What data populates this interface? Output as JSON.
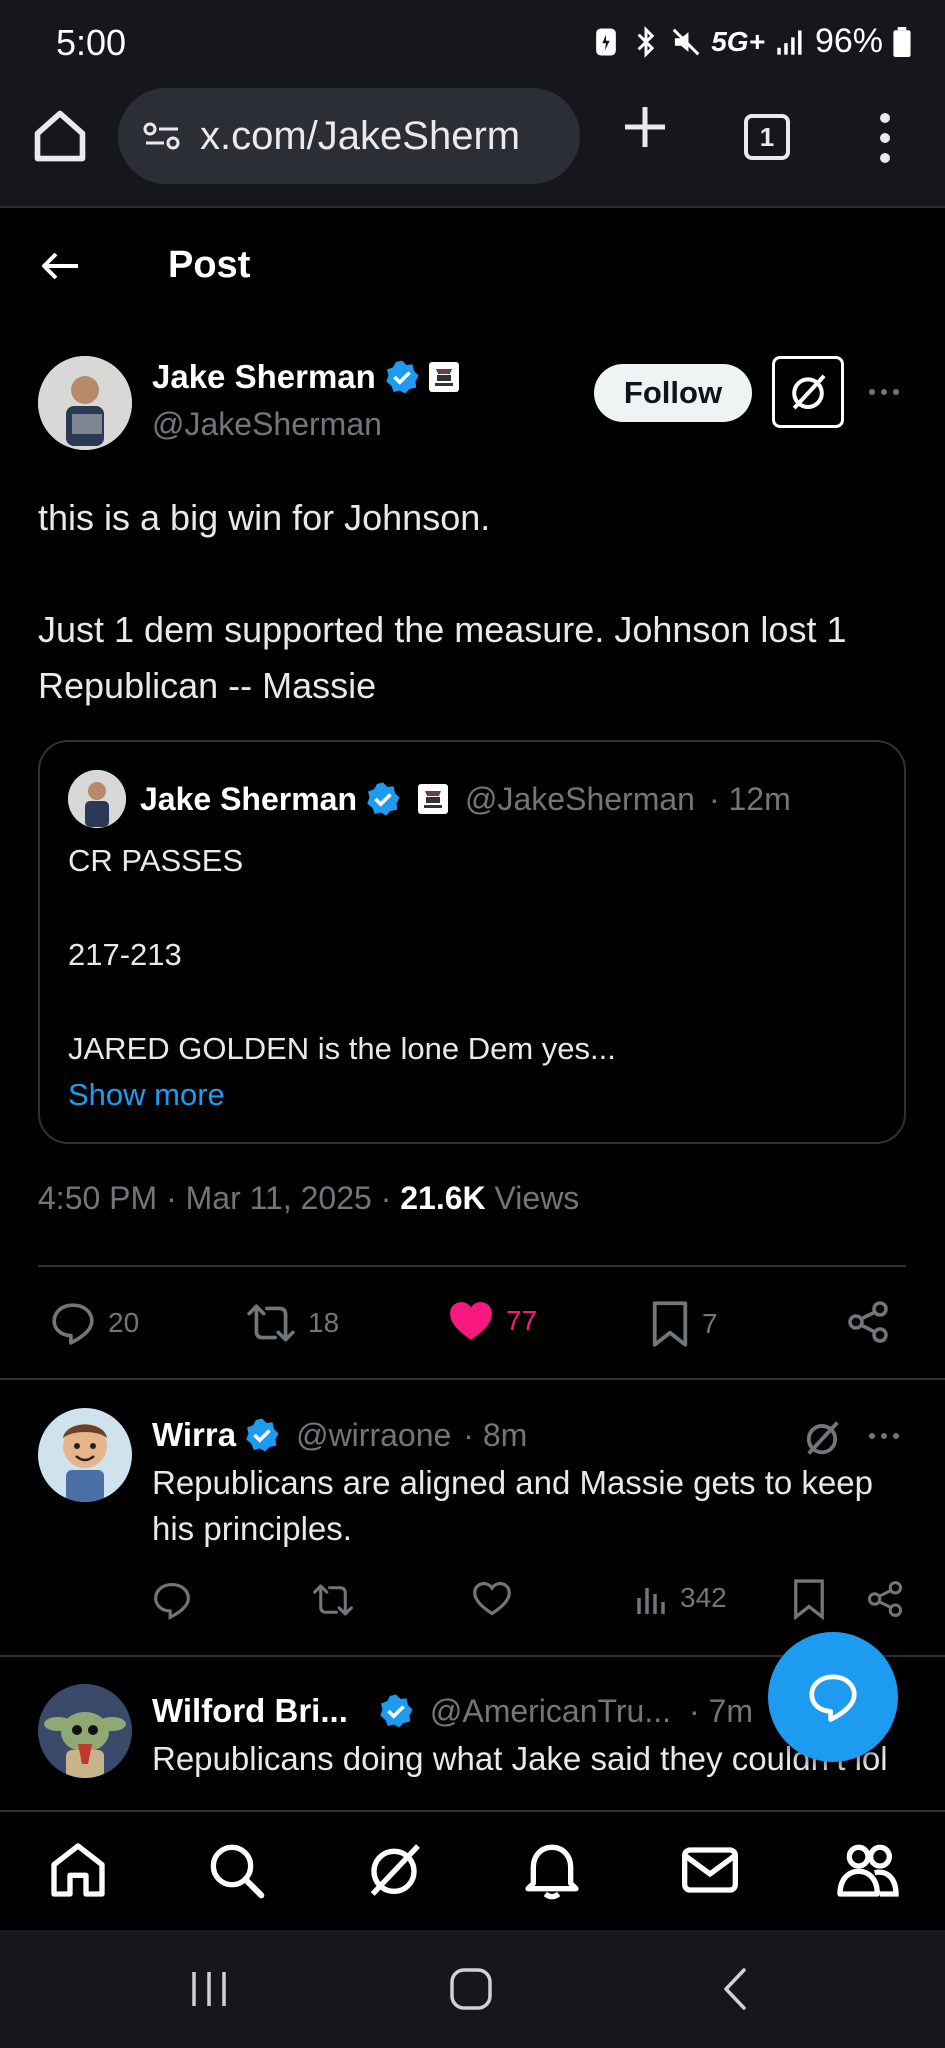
{
  "status_bar": {
    "time": "5:00",
    "network": "5G+",
    "battery": "96%"
  },
  "browser": {
    "url": "x.com/JakeSherm",
    "tab_count": "1"
  },
  "header": {
    "title": "Post"
  },
  "post": {
    "author_name": "Jake Sherman",
    "author_handle": "@JakeSherman",
    "follow_label": "Follow",
    "text_lines": [
      "this is a big win for Johnson.",
      "Just 1 dem supported the measure. Johnson lost 1 Republican -- Massie"
    ],
    "quote": {
      "author_name": "Jake Sherman",
      "author_handle": "@JakeSherman",
      "time": "· 12m",
      "line1": "CR PASSES",
      "line2": "217-213",
      "line3": "JARED GOLDEN is the lone Dem yes...",
      "show_more": "Show more"
    },
    "meta_time": "4:50 PM · Mar 11, 2025 · ",
    "views_count": "21.6K",
    "views_label": " Views",
    "stats": {
      "replies": "20",
      "reposts": "18",
      "likes": "77",
      "bookmarks": "7"
    },
    "colors": {
      "like": "#f91880",
      "verified": "#1d9bf0",
      "link": "#1d9bf0"
    }
  },
  "replies": [
    {
      "name": "Wirra",
      "handle": "@wirraone",
      "time": "· 8m",
      "text": "Republicans are aligned and Massie gets to keep his principles.",
      "views": "342"
    },
    {
      "name": "Wilford Bri...",
      "handle": "@AmericanTru...",
      "time": "· 7m",
      "text": "Republicans doing what Jake said they couldn’t lol"
    }
  ],
  "tabbar": {
    "items": [
      "home-icon",
      "search-icon",
      "grok-icon",
      "notifications-icon",
      "messages-icon",
      "communities-icon"
    ]
  }
}
